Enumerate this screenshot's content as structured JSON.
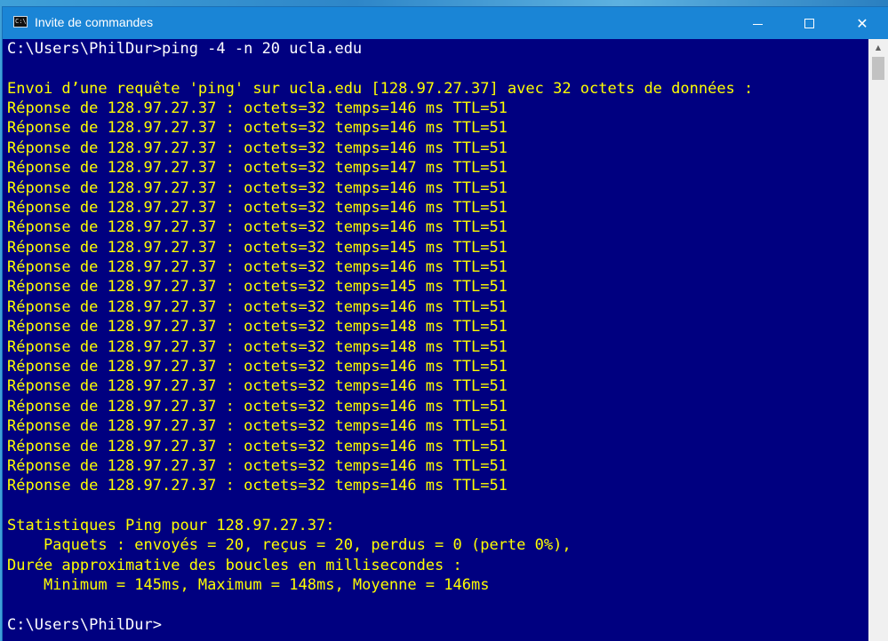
{
  "window": {
    "title": "Invite de commandes",
    "icon_text": "C:\\",
    "controls": {
      "minimize_icon": "minimize-icon",
      "maximize_icon": "maximize-icon",
      "close_icon": "close-icon",
      "close_glyph": "✕"
    }
  },
  "colors": {
    "console_background": "#000080",
    "console_text": "#ffff00",
    "prompt_text": "#ffffff",
    "titlebar": "#1a85d6"
  },
  "console": {
    "command_line": "C:\\Users\\PhilDur>ping -4 -n 20 ucla.edu",
    "header": "Envoi d’une requête 'ping' sur ucla.edu [128.97.27.37] avec 32 octets de données :",
    "replies": [
      "Réponse de 128.97.27.37 : octets=32 temps=146 ms TTL=51",
      "Réponse de 128.97.27.37 : octets=32 temps=146 ms TTL=51",
      "Réponse de 128.97.27.37 : octets=32 temps=146 ms TTL=51",
      "Réponse de 128.97.27.37 : octets=32 temps=147 ms TTL=51",
      "Réponse de 128.97.27.37 : octets=32 temps=146 ms TTL=51",
      "Réponse de 128.97.27.37 : octets=32 temps=146 ms TTL=51",
      "Réponse de 128.97.27.37 : octets=32 temps=146 ms TTL=51",
      "Réponse de 128.97.27.37 : octets=32 temps=145 ms TTL=51",
      "Réponse de 128.97.27.37 : octets=32 temps=146 ms TTL=51",
      "Réponse de 128.97.27.37 : octets=32 temps=145 ms TTL=51",
      "Réponse de 128.97.27.37 : octets=32 temps=146 ms TTL=51",
      "Réponse de 128.97.27.37 : octets=32 temps=148 ms TTL=51",
      "Réponse de 128.97.27.37 : octets=32 temps=148 ms TTL=51",
      "Réponse de 128.97.27.37 : octets=32 temps=146 ms TTL=51",
      "Réponse de 128.97.27.37 : octets=32 temps=146 ms TTL=51",
      "Réponse de 128.97.27.37 : octets=32 temps=146 ms TTL=51",
      "Réponse de 128.97.27.37 : octets=32 temps=146 ms TTL=51",
      "Réponse de 128.97.27.37 : octets=32 temps=146 ms TTL=51",
      "Réponse de 128.97.27.37 : octets=32 temps=146 ms TTL=51",
      "Réponse de 128.97.27.37 : octets=32 temps=146 ms TTL=51"
    ],
    "stats_title": "Statistiques Ping pour 128.97.27.37:",
    "stats_packets": "    Paquets : envoyés = 20, reçus = 20, perdus = 0 (perte 0%),",
    "rtt_title": "Durée approximative des boucles en millisecondes :",
    "rtt_values": "    Minimum = 145ms, Maximum = 148ms, Moyenne = 146ms",
    "final_prompt": "C:\\Users\\PhilDur>"
  }
}
